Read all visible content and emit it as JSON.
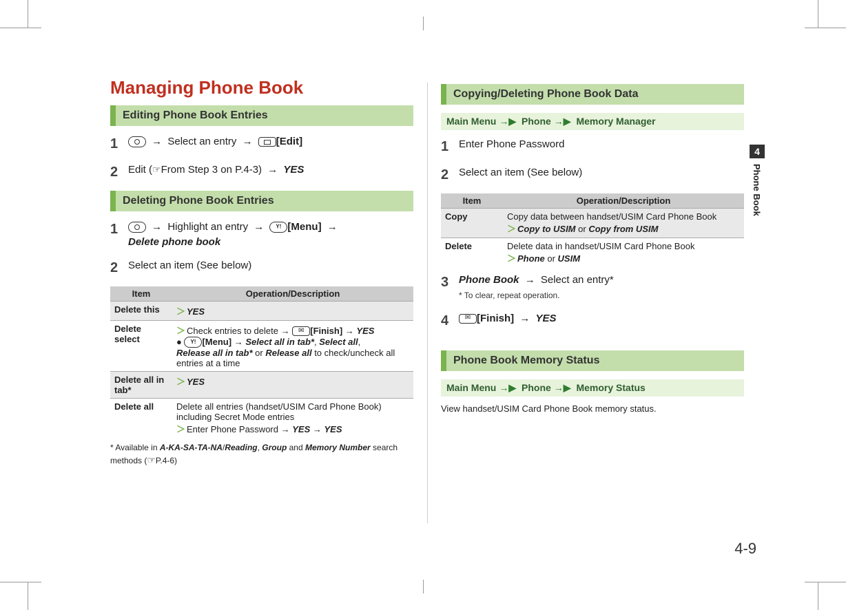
{
  "page": {
    "number": "4-9",
    "sideTabNumber": "4",
    "sideTabLabel": "Phone Book"
  },
  "left": {
    "title": "Managing Phone Book",
    "sectionEdit": "Editing Phone Book Entries",
    "editStep1": {
      "selectEntry": "Select an entry",
      "editLabel": "[Edit]"
    },
    "editStep2": {
      "prefix": "Edit (",
      "ref": "From Step 3 on P.4-3)",
      "yes": "YES"
    },
    "sectionDelete": "Deleting Phone Book Entries",
    "delStep1": {
      "highlight": "Highlight an entry",
      "menuLabel": "[Menu]",
      "deletePB": "Delete phone book"
    },
    "delStep2": "Select an item (See below)",
    "tableHeader": {
      "item": "Item",
      "op": "Operation/Description"
    },
    "tableRows": {
      "r1": {
        "item": "Delete this",
        "yes": "YES"
      },
      "r2": {
        "item": "Delete select",
        "check": "Check entries to delete",
        "finish": "[Finish]",
        "yes": "YES",
        "menu": "[Menu]",
        "selAllTab": "Select all in tab*",
        "selAll": "Select all",
        "relAllTab": "Release all in tab*",
        "relAll": "Release all",
        "tail": " to check/uncheck all entries at a time"
      },
      "r3": {
        "item": "Delete all in tab*",
        "yes": "YES"
      },
      "r4": {
        "item": "Delete all",
        "desc1": "Delete all entries (handset/USIM Card Phone Book) including Secret Mode entries",
        "enterPw": "Enter Phone Password",
        "yes": "YES"
      }
    },
    "footnote": {
      "prefix": "* Available in ",
      "aka": "A-KA-SA-TA-NA",
      "reading": "Reading",
      "group": "Group",
      "memnum": "Memory Number",
      "suffix": " search methods (",
      "ref": "P.4-6)"
    }
  },
  "right": {
    "sectionCopy": "Copying/Deleting Phone Book Data",
    "crumb1": {
      "main": "Main Menu",
      "phone": "Phone",
      "mm": "Memory Manager"
    },
    "step1": "Enter Phone Password",
    "step2": "Select an item (See below)",
    "tableHeader": {
      "item": "Item",
      "op": "Operation/Description"
    },
    "tableRows": {
      "r1": {
        "item": "Copy",
        "desc": "Copy data between handset/USIM Card Phone Book",
        "toUsim": "Copy to USIM",
        "or": " or ",
        "fromUsim": "Copy from USIM"
      },
      "r2": {
        "item": "Delete",
        "desc": "Delete data in handset/USIM Card Phone Book",
        "phone": "Phone",
        "or": " or ",
        "usim": "USIM"
      }
    },
    "step3": {
      "pb": "Phone Book",
      "sel": "Select an entry*",
      "note": "* To clear, repeat operation."
    },
    "step4": {
      "finish": "[Finish]",
      "yes": "YES"
    },
    "sectionStatus": "Phone Book Memory Status",
    "crumb2": {
      "main": "Main Menu",
      "phone": "Phone",
      "ms": "Memory Status"
    },
    "statusText": "View handset/USIM Card Phone Book memory status."
  }
}
